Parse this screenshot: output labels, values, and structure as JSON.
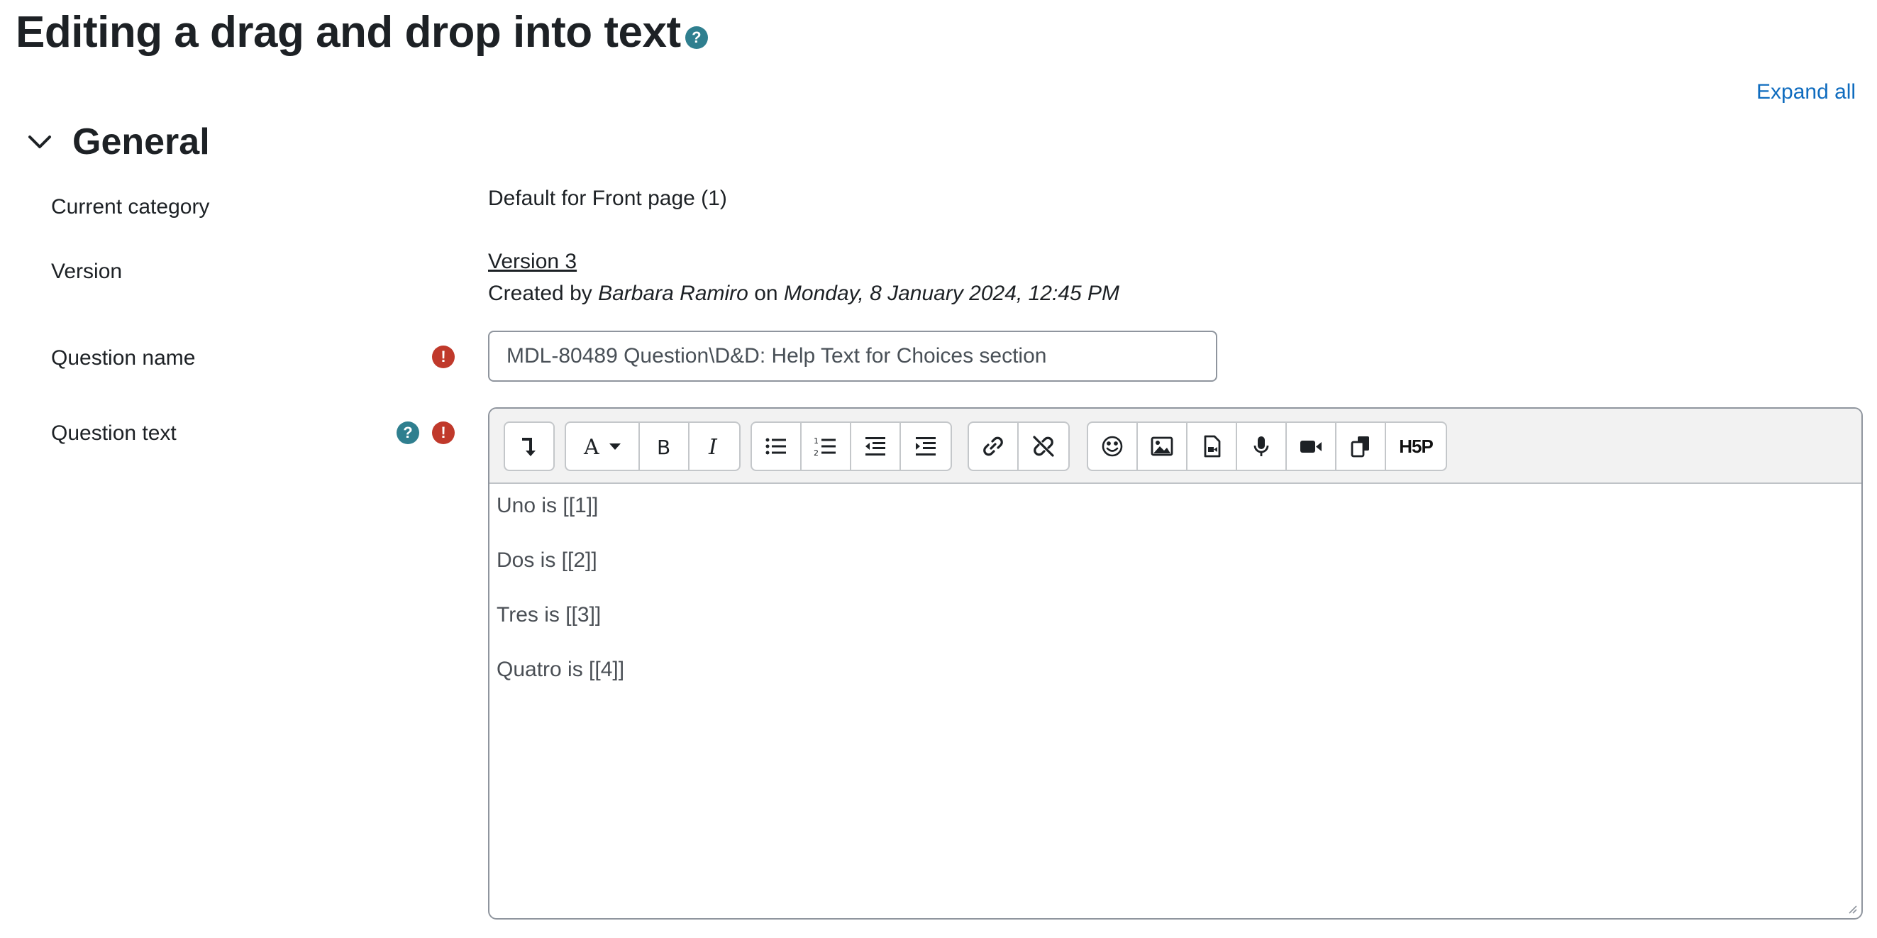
{
  "page": {
    "title": "Editing a drag and drop into text",
    "help_icon": "question-mark-icon"
  },
  "expand_all": "Expand all",
  "section": {
    "title": "General",
    "toggle_icon": "chevron-down-icon"
  },
  "fields": {
    "category_label": "Current category",
    "category_value": "Default for Front page (1)",
    "version_label": "Version",
    "version_link": "Version 3",
    "created_by": {
      "prefix": "Created by",
      "author": "Barbara Ramiro",
      "on": "on",
      "date": "Monday, 8 January 2024, 12:45 PM"
    },
    "name_label": "Question name",
    "name_value": "MDL-80489 Question\\D&D: Help Text for Choices section",
    "text_label": "Question text"
  },
  "editor": {
    "toolbar_icons": [
      "collapse-icon",
      "font-color-icon",
      "bold-icon",
      "italic-icon",
      "unordered-list-icon",
      "ordered-list-icon",
      "outdent-icon",
      "indent-icon",
      "link-icon",
      "unlink-icon",
      "emoji-icon",
      "image-icon",
      "media-icon",
      "record-audio-icon",
      "record-video-icon",
      "manage-files-icon",
      "h5p-icon"
    ],
    "h5p_label": "H5P",
    "lines": [
      "Uno is [[1]]",
      "Dos is [[2]]",
      "Tres is [[3]]",
      "Quatro is [[4]]"
    ]
  },
  "colors": {
    "help": "#2f7f8f",
    "error": "#c0392b",
    "link": "#0f6cbf"
  }
}
